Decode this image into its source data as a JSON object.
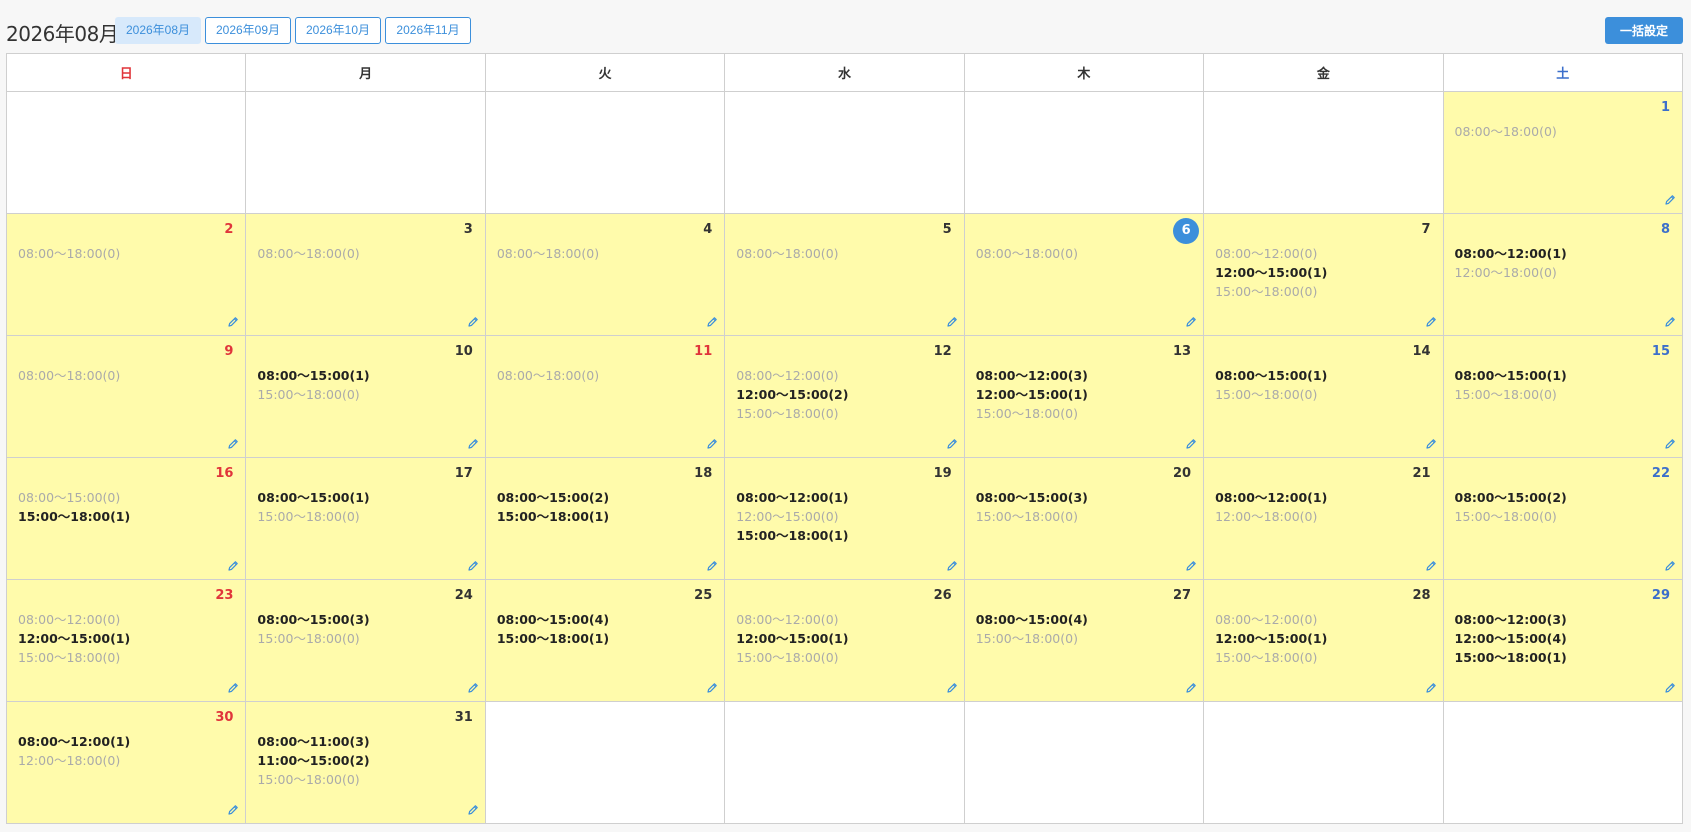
{
  "header": {
    "title": "2026年08月",
    "months": [
      "2026年08月",
      "2026年09月",
      "2026年10月",
      "2026年11月"
    ],
    "active_month": 0,
    "bulk_button": "一括設定"
  },
  "weekdays": [
    "日",
    "月",
    "火",
    "水",
    "木",
    "金",
    "土"
  ],
  "today": 6,
  "colors": {
    "cell_active": "#fffbab",
    "accent": "#3c8fdb",
    "sunday": "#e0353b",
    "saturday": "#3c6fcb"
  },
  "days": [
    {
      "day": 1,
      "slots": [
        {
          "t": "08:00〜18:00(0)",
          "b": false
        }
      ]
    },
    {
      "day": 2,
      "slots": [
        {
          "t": "08:00〜18:00(0)",
          "b": false
        }
      ]
    },
    {
      "day": 3,
      "slots": [
        {
          "t": "08:00〜18:00(0)",
          "b": false
        }
      ]
    },
    {
      "day": 4,
      "slots": [
        {
          "t": "08:00〜18:00(0)",
          "b": false
        }
      ]
    },
    {
      "day": 5,
      "slots": [
        {
          "t": "08:00〜18:00(0)",
          "b": false
        }
      ]
    },
    {
      "day": 6,
      "slots": [
        {
          "t": "08:00〜18:00(0)",
          "b": false
        }
      ]
    },
    {
      "day": 7,
      "slots": [
        {
          "t": "08:00〜12:00(0)",
          "b": false
        },
        {
          "t": "12:00〜15:00(1)",
          "b": true
        },
        {
          "t": "15:00〜18:00(0)",
          "b": false
        }
      ]
    },
    {
      "day": 8,
      "slots": [
        {
          "t": "08:00〜12:00(1)",
          "b": true
        },
        {
          "t": "12:00〜18:00(0)",
          "b": false
        }
      ]
    },
    {
      "day": 9,
      "slots": [
        {
          "t": "08:00〜18:00(0)",
          "b": false
        }
      ]
    },
    {
      "day": 10,
      "slots": [
        {
          "t": "08:00〜15:00(1)",
          "b": true
        },
        {
          "t": "15:00〜18:00(0)",
          "b": false
        }
      ]
    },
    {
      "day": 11,
      "holiday": true,
      "slots": [
        {
          "t": "08:00〜18:00(0)",
          "b": false
        }
      ]
    },
    {
      "day": 12,
      "slots": [
        {
          "t": "08:00〜12:00(0)",
          "b": false
        },
        {
          "t": "12:00〜15:00(2)",
          "b": true
        },
        {
          "t": "15:00〜18:00(0)",
          "b": false
        }
      ]
    },
    {
      "day": 13,
      "slots": [
        {
          "t": "08:00〜12:00(3)",
          "b": true
        },
        {
          "t": "12:00〜15:00(1)",
          "b": true
        },
        {
          "t": "15:00〜18:00(0)",
          "b": false
        }
      ]
    },
    {
      "day": 14,
      "slots": [
        {
          "t": "08:00〜15:00(1)",
          "b": true
        },
        {
          "t": "15:00〜18:00(0)",
          "b": false
        }
      ]
    },
    {
      "day": 15,
      "slots": [
        {
          "t": "08:00〜15:00(1)",
          "b": true
        },
        {
          "t": "15:00〜18:00(0)",
          "b": false
        }
      ]
    },
    {
      "day": 16,
      "slots": [
        {
          "t": "08:00〜15:00(0)",
          "b": false
        },
        {
          "t": "15:00〜18:00(1)",
          "b": true
        }
      ]
    },
    {
      "day": 17,
      "slots": [
        {
          "t": "08:00〜15:00(1)",
          "b": true
        },
        {
          "t": "15:00〜18:00(0)",
          "b": false
        }
      ]
    },
    {
      "day": 18,
      "slots": [
        {
          "t": "08:00〜15:00(2)",
          "b": true
        },
        {
          "t": "15:00〜18:00(1)",
          "b": true
        }
      ]
    },
    {
      "day": 19,
      "slots": [
        {
          "t": "08:00〜12:00(1)",
          "b": true
        },
        {
          "t": "12:00〜15:00(0)",
          "b": false
        },
        {
          "t": "15:00〜18:00(1)",
          "b": true
        }
      ]
    },
    {
      "day": 20,
      "slots": [
        {
          "t": "08:00〜15:00(3)",
          "b": true
        },
        {
          "t": "15:00〜18:00(0)",
          "b": false
        }
      ]
    },
    {
      "day": 21,
      "slots": [
        {
          "t": "08:00〜12:00(1)",
          "b": true
        },
        {
          "t": "12:00〜18:00(0)",
          "b": false
        }
      ]
    },
    {
      "day": 22,
      "slots": [
        {
          "t": "08:00〜15:00(2)",
          "b": true
        },
        {
          "t": "15:00〜18:00(0)",
          "b": false
        }
      ]
    },
    {
      "day": 23,
      "slots": [
        {
          "t": "08:00〜12:00(0)",
          "b": false
        },
        {
          "t": "12:00〜15:00(1)",
          "b": true
        },
        {
          "t": "15:00〜18:00(0)",
          "b": false
        }
      ]
    },
    {
      "day": 24,
      "slots": [
        {
          "t": "08:00〜15:00(3)",
          "b": true
        },
        {
          "t": "15:00〜18:00(0)",
          "b": false
        }
      ]
    },
    {
      "day": 25,
      "slots": [
        {
          "t": "08:00〜15:00(4)",
          "b": true
        },
        {
          "t": "15:00〜18:00(1)",
          "b": true
        }
      ]
    },
    {
      "day": 26,
      "slots": [
        {
          "t": "08:00〜12:00(0)",
          "b": false
        },
        {
          "t": "12:00〜15:00(1)",
          "b": true
        },
        {
          "t": "15:00〜18:00(0)",
          "b": false
        }
      ]
    },
    {
      "day": 27,
      "slots": [
        {
          "t": "08:00〜15:00(4)",
          "b": true
        },
        {
          "t": "15:00〜18:00(0)",
          "b": false
        }
      ]
    },
    {
      "day": 28,
      "slots": [
        {
          "t": "08:00〜12:00(0)",
          "b": false
        },
        {
          "t": "12:00〜15:00(1)",
          "b": true
        },
        {
          "t": "15:00〜18:00(0)",
          "b": false
        }
      ]
    },
    {
      "day": 29,
      "slots": [
        {
          "t": "08:00〜12:00(3)",
          "b": true
        },
        {
          "t": "12:00〜15:00(4)",
          "b": true
        },
        {
          "t": "15:00〜18:00(1)",
          "b": true
        }
      ]
    },
    {
      "day": 30,
      "slots": [
        {
          "t": "08:00〜12:00(1)",
          "b": true
        },
        {
          "t": "12:00〜18:00(0)",
          "b": false
        }
      ]
    },
    {
      "day": 31,
      "slots": [
        {
          "t": "08:00〜11:00(3)",
          "b": true
        },
        {
          "t": "11:00〜15:00(2)",
          "b": true
        },
        {
          "t": "15:00〜18:00(0)",
          "b": false
        }
      ]
    }
  ]
}
